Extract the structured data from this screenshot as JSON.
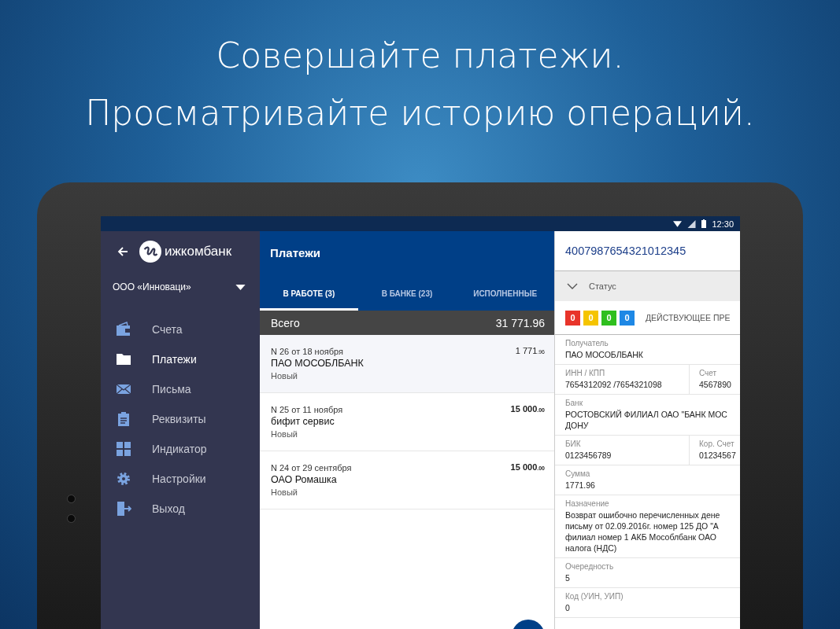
{
  "headline": [
    "Совершайте платежи.",
    "Просматривайте историю операций."
  ],
  "status_bar": {
    "time": "12:30"
  },
  "sidebar": {
    "brand": "ижкомбанк",
    "organization": "ООО «Инноваци»",
    "items": [
      {
        "label": "Счета",
        "kind": "wallet",
        "selected": false
      },
      {
        "label": "Платежи",
        "kind": "folder",
        "selected": true
      },
      {
        "label": "Письма",
        "kind": "mail",
        "selected": false
      },
      {
        "label": "Реквизиты",
        "kind": "clipboard",
        "selected": false
      },
      {
        "label": "Индикатор",
        "kind": "grid",
        "selected": false
      },
      {
        "label": "Настройки",
        "kind": "gear",
        "selected": false
      },
      {
        "label": "Выход",
        "kind": "exit",
        "selected": false
      }
    ]
  },
  "payments": {
    "title": "Платежи",
    "tabs": [
      {
        "label": "В РАБОТЕ (3)",
        "selected": true
      },
      {
        "label": "В БАНКЕ (23)",
        "selected": false
      },
      {
        "label": "ИСПОЛНЕННЫЕ",
        "selected": false
      }
    ],
    "total": {
      "label": "Всего",
      "amount": "31 771.96"
    },
    "rows": [
      {
        "number": "N 26 от 18 ноября",
        "payee": "ПАО МОСОБЛБАНК",
        "status": "Новый",
        "amount": "1 771",
        "cents": ".96",
        "selected": true
      },
      {
        "number": "N 25 от 11 ноября",
        "payee": "бифит сервис",
        "status": "Новый",
        "amount": "15 000",
        "cents": ".00",
        "selected": false
      },
      {
        "number": "N 24 от 29 сентября",
        "payee": "ОАО Ромашка",
        "status": "Новый",
        "amount": "15 000",
        "cents": ".00",
        "selected": false
      }
    ]
  },
  "detail": {
    "number": "4007987654321012345",
    "status_label": "Статус",
    "counters": [
      {
        "value": "0",
        "color": "#e8342a"
      },
      {
        "value": "0",
        "color": "#f5c400"
      },
      {
        "value": "0",
        "color": "#2fbf1e"
      },
      {
        "value": "0",
        "color": "#1e88e5"
      }
    ],
    "status_text": "ДЕЙСТВУЮЩЕЕ ПРЕ",
    "fields": [
      {
        "kind": "single",
        "label": "Получатель",
        "lines": [
          "ПАО МОСОБЛБАНК"
        ]
      },
      {
        "kind": "pair",
        "cells": [
          {
            "label": "ИНН / КПП",
            "lines": [
              "7654312092 /7654321098"
            ]
          },
          {
            "label": "Счет",
            "lines": [
              "4567890"
            ]
          }
        ]
      },
      {
        "kind": "single",
        "label": "Банк",
        "lines": [
          "РОСТОВСКИЙ ФИЛИАЛ ОАО \"БАНК МОС",
          "ДОНУ"
        ]
      },
      {
        "kind": "pair",
        "cells": [
          {
            "label": "БИК",
            "lines": [
              "0123456789"
            ]
          },
          {
            "label": "Кор. Счет",
            "lines": [
              "01234567"
            ]
          }
        ]
      },
      {
        "kind": "single",
        "label": "Сумма",
        "lines": [
          "1771.96"
        ]
      },
      {
        "kind": "single",
        "label": "Назначение",
        "lines": [
          "Возврат ошибочно перечисленных дене",
          "письму от 02.09.2016г. номер 125 ДО \"А",
          "филиал номер 1 АКБ Мособлбанк ОАО",
          "налога (НДС)"
        ]
      },
      {
        "kind": "single",
        "label": "Очередность",
        "lines": [
          "5"
        ]
      },
      {
        "kind": "single",
        "label": "Код (УИН, УИП)",
        "lines": [
          "0"
        ]
      }
    ]
  }
}
